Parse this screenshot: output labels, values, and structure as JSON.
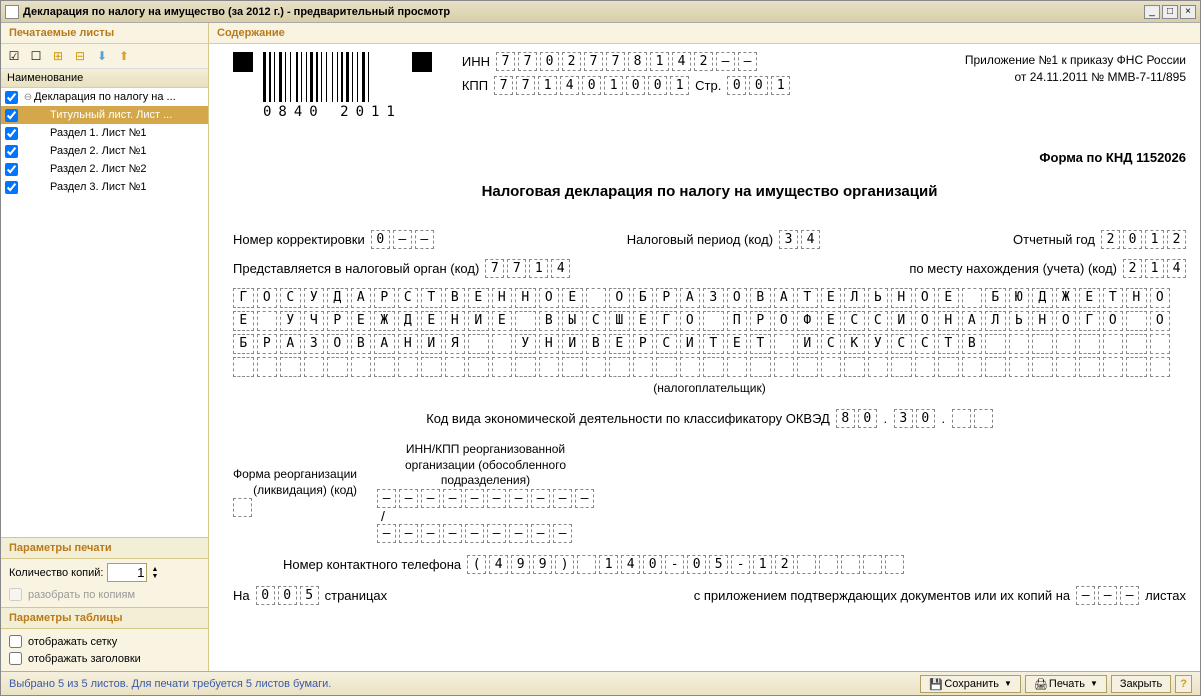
{
  "window": {
    "title": "Декларация по налогу на имущество (за 2012 г.) - предварительный просмотр"
  },
  "headers": {
    "left": "Печатаемые листы",
    "right": "Содержание"
  },
  "tree": {
    "header": "Наименование",
    "rows": [
      {
        "label": "Декларация по налогу на ...",
        "indent": 0,
        "checked": true,
        "expanded": true,
        "selected": false
      },
      {
        "label": "Титульный лист. Лист ...",
        "indent": 1,
        "checked": true,
        "selected": true
      },
      {
        "label": "Раздел 1. Лист №1",
        "indent": 1,
        "checked": true,
        "selected": false
      },
      {
        "label": "Раздел 2. Лист №1",
        "indent": 1,
        "checked": true,
        "selected": false
      },
      {
        "label": "Раздел 2. Лист №2",
        "indent": 1,
        "checked": true,
        "selected": false
      },
      {
        "label": "Раздел 3. Лист №1",
        "indent": 1,
        "checked": true,
        "selected": false
      }
    ]
  },
  "print_params": {
    "header": "Параметры печати",
    "copies_label": "Количество копий:",
    "copies_value": "1",
    "split_label": "разобрать по копиям"
  },
  "table_params": {
    "header": "Параметры таблицы",
    "grid_label": "отображать сетку",
    "headers_label": "отображать заголовки"
  },
  "doc": {
    "barcode_num": "0840 2011",
    "inn_label": "ИНН",
    "inn": [
      "7",
      "7",
      "0",
      "2",
      "7",
      "7",
      "8",
      "1",
      "4",
      "2",
      "–",
      "–"
    ],
    "kpp_label": "КПП",
    "kpp": [
      "7",
      "7",
      "1",
      "4",
      "0",
      "1",
      "0",
      "0",
      "1"
    ],
    "page_label": "Стр.",
    "page": [
      "0",
      "0",
      "1"
    ],
    "annex_line1": "Приложение №1 к приказу ФНС России",
    "annex_line2": "от 24.11.2011 № ММВ-7-11/895",
    "knd": "Форма по КНД 1152026",
    "title": "Налоговая декларация по налогу на имущество организаций",
    "corr_label": "Номер корректировки",
    "corr": [
      "0",
      "–",
      "–"
    ],
    "period_label": "Налоговый период  (код)",
    "period": [
      "3",
      "4"
    ],
    "year_label": "Отчетный год",
    "year": [
      "2",
      "0",
      "1",
      "2"
    ],
    "organ_label": "Представляется в налоговый орган  (код)",
    "organ": [
      "7",
      "7",
      "1",
      "4"
    ],
    "place_label": "по месту нахождения (учета)  (код)",
    "place": [
      "2",
      "1",
      "4"
    ],
    "payer_rows": [
      [
        "Г",
        "О",
        "С",
        "У",
        "Д",
        "А",
        "Р",
        "С",
        "Т",
        "В",
        "Е",
        "Н",
        "Н",
        "О",
        "Е",
        "",
        "О",
        "Б",
        "Р",
        "А",
        "З",
        "О",
        "В",
        "А",
        "Т",
        "Е",
        "Л",
        "Ь",
        "Н",
        "О",
        "Е",
        "",
        "Б",
        "Ю",
        "Д",
        "Ж",
        "Е",
        "Т",
        "Н",
        "О"
      ],
      [
        "Е",
        "",
        "У",
        "Ч",
        "Р",
        "Е",
        "Ж",
        "Д",
        "Е",
        "Н",
        "И",
        "Е",
        "",
        "В",
        "Ы",
        "С",
        "Ш",
        "Е",
        "Г",
        "О",
        "",
        "П",
        "Р",
        "О",
        "Ф",
        "Е",
        "С",
        "С",
        "И",
        "О",
        "Н",
        "А",
        "Л",
        "Ь",
        "Н",
        "О",
        "Г",
        "О",
        "",
        "О"
      ],
      [
        "Б",
        "Р",
        "А",
        "З",
        "О",
        "В",
        "А",
        "Н",
        "И",
        "Я",
        "",
        "",
        "У",
        "Н",
        "И",
        "В",
        "Е",
        "Р",
        "С",
        "И",
        "Т",
        "Е",
        "Т",
        "",
        "И",
        "С",
        "К",
        "У",
        "С",
        "С",
        "Т",
        "В",
        "",
        "",
        "",
        "",
        "",
        "",
        "",
        ""
      ],
      [
        "",
        "",
        "",
        "",
        "",
        "",
        "",
        "",
        "",
        "",
        "",
        "",
        "",
        "",
        "",
        "",
        "",
        "",
        "",
        "",
        "",
        "",
        "",
        "",
        "",
        "",
        "",
        "",
        "",
        "",
        "",
        "",
        "",
        "",
        "",
        "",
        "",
        "",
        "",
        ""
      ]
    ],
    "payer_caption": "(налогоплательщик)",
    "okved_label": "Код вида экономической деятельности по классификатору ОКВЭД",
    "okved1": [
      "8",
      "0"
    ],
    "okved2": [
      "3",
      "0"
    ],
    "okved3": [
      "",
      ""
    ],
    "reorg_form_label1": "Форма реорганизации",
    "reorg_form_label2": "(ликвидация) (код)",
    "reorg_inn_label1": "ИНН/КПП реорганизованной",
    "reorg_inn_label2": "организации (обособленного",
    "reorg_inn_label3": "подразделения)",
    "reorg_inn": [
      "–",
      "–",
      "–",
      "–",
      "–",
      "–",
      "–",
      "–",
      "–",
      "–"
    ],
    "reorg_kpp": [
      "–",
      "–",
      "–",
      "–",
      "–",
      "–",
      "–",
      "–",
      "–"
    ],
    "phone_label": "Номер контактного телефона",
    "phone": [
      "(",
      "4",
      "9",
      "9",
      ")",
      "",
      "1",
      "4",
      "0",
      "-",
      "0",
      "5",
      "-",
      "1",
      "2",
      "",
      "",
      "",
      "",
      ""
    ],
    "pages_prefix": "На",
    "pages": [
      "0",
      "0",
      "5"
    ],
    "pages_suffix": "страницах",
    "attach_label": "с приложением подтверждающих документов или их копий на",
    "attach": [
      "–",
      "–",
      "–"
    ],
    "sheets_label": "листах"
  },
  "status": {
    "text": "Выбрано 5 из 5 листов. Для печати требуется 5 листов бумаги.",
    "save": "Сохранить",
    "print": "Печать",
    "close": "Закрыть"
  }
}
